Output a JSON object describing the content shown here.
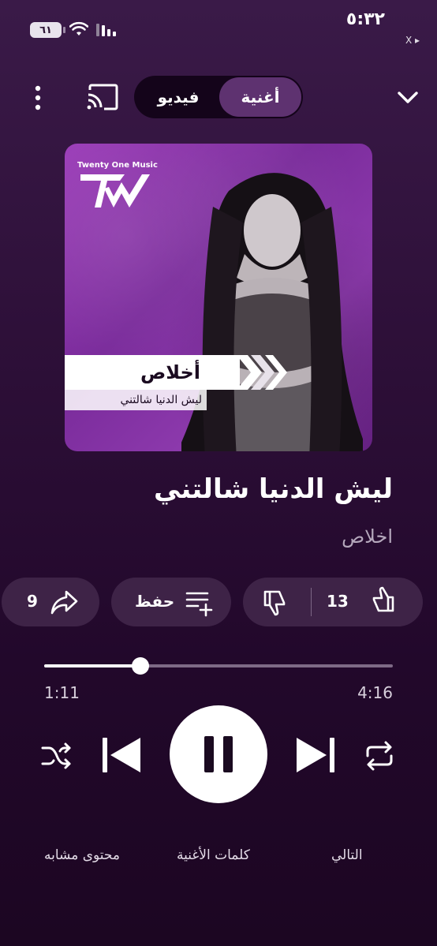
{
  "status_bar": {
    "time": "٥:٣٢",
    "battery": "٦١",
    "back_app": "X ▸"
  },
  "header": {
    "tabs": {
      "song": "أغنية",
      "video": "فيديو"
    }
  },
  "album_art": {
    "label_name": "Twenty One Music",
    "artist_banner": "أخلاص",
    "song_banner": "ليش الدنيا شالتني"
  },
  "track": {
    "title": "ليش الدنيا شالتني",
    "artist": "اخلاص"
  },
  "actions": {
    "likes": "13",
    "save_label": "حفظ",
    "shares": "9"
  },
  "progress": {
    "elapsed": "1:11",
    "total": "4:16",
    "fraction": 0.277
  },
  "bottom_tabs": {
    "next": "التالي",
    "lyrics": "كلمات الأغنية",
    "related": "محتوى مشابه"
  },
  "colors": {
    "accent": "#5e3270",
    "background": "#2e1039",
    "pill": "#3e2347"
  },
  "icons": [
    "wifi-icon",
    "signal-icon",
    "more-icon",
    "cast-icon",
    "chevron-down-icon",
    "thumbs-up-icon",
    "thumbs-down-icon",
    "add-to-queue-icon",
    "share-icon",
    "shuffle-icon",
    "previous-icon",
    "pause-icon",
    "next-icon",
    "repeat-icon"
  ]
}
